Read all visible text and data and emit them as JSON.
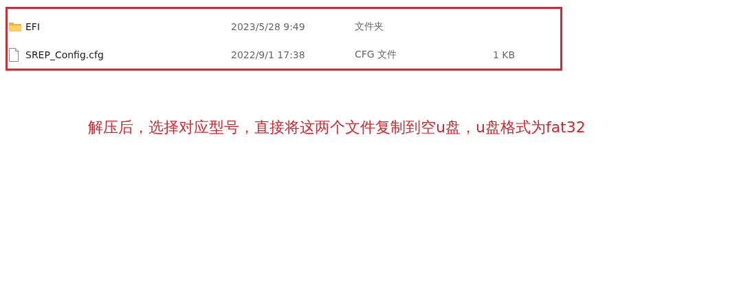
{
  "files": [
    {
      "kind": "folder",
      "name": "EFI",
      "modified": "2023/5/28 9:49",
      "type": "文件夹"
    },
    {
      "kind": "file",
      "name": "SREP_Config.cfg",
      "modified": "2022/9/1 17:38",
      "type": "CFG 文件",
      "size": "1 KB"
    }
  ],
  "annotation": "解压后，选择对应型号，直接将这两个文件复制到空u盘，u盘格式为fat32"
}
